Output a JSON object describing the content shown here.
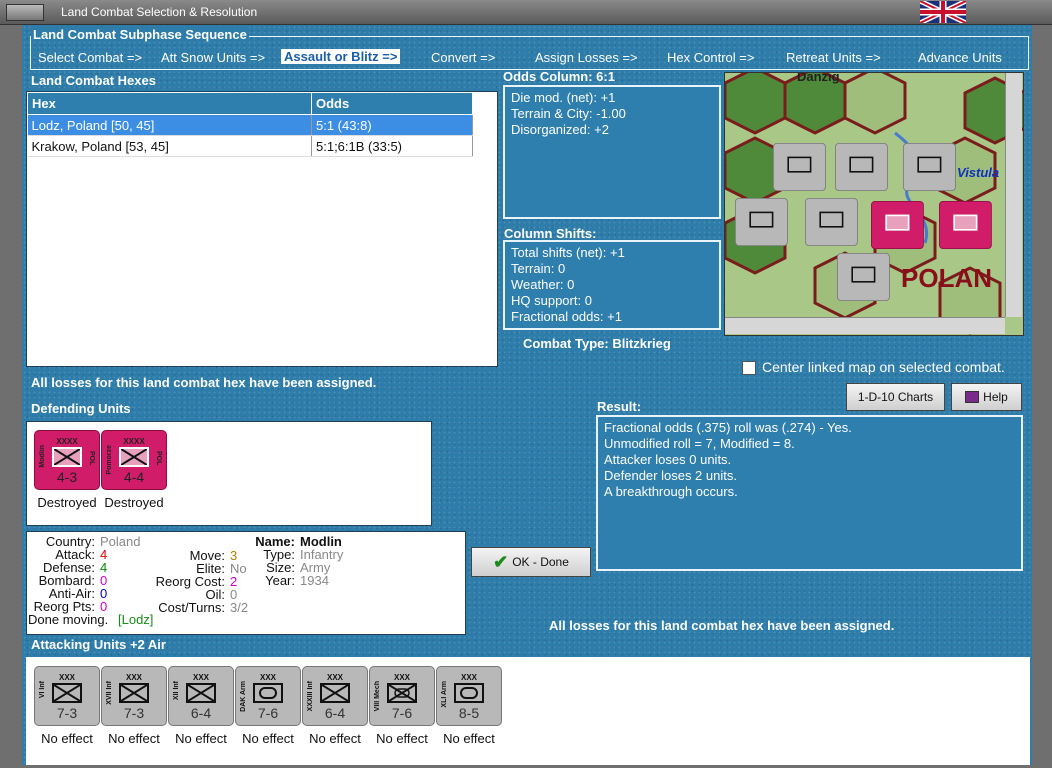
{
  "window": {
    "title": "Land Combat Selection & Resolution"
  },
  "sequence": {
    "title": "Land Combat Subphase Sequence",
    "steps": [
      "Select Combat =>",
      "Att Snow Units =>",
      "Assault or Blitz =>",
      "Convert =>",
      "Assign Losses =>",
      "Hex Control =>",
      "Retreat Units =>",
      "Advance Units"
    ],
    "active_step": "Assault or Blitz =>"
  },
  "hexes": {
    "title": "Land Combat Hexes",
    "columns": [
      "Hex",
      "Odds"
    ],
    "rows": [
      {
        "hex": "Lodz, Poland [50, 45]",
        "odds": "5:1 (43:8)"
      },
      {
        "hex": "Krakow, Poland [53, 45]",
        "odds": "5:1;6:1B (33:5)"
      }
    ]
  },
  "odds": {
    "title": "Odds Column: 6:1",
    "lines": [
      "Die mod. (net): +1",
      "Terrain & City: -1.00",
      "Disorganized: +2"
    ]
  },
  "shifts": {
    "title": "Column Shifts:",
    "lines": [
      "Total shifts (net): +1",
      "Terrain: 0",
      "Weather: 0",
      "HQ support: 0",
      "Fractional odds: +1"
    ]
  },
  "combat_type": "Combat Type:  Blitzkrieg",
  "center_map_label": "Center linked map on selected combat.",
  "losses_note": "All losses for this land combat hex have been assigned.",
  "buttons": {
    "charts": "1-D-10 Charts",
    "help": "Help",
    "done": "OK - Done"
  },
  "defenders": {
    "title": "Defending Units",
    "units": [
      {
        "size": "XXXX",
        "name": "Modlin",
        "nation": "POL",
        "strength": "4-3",
        "status": "Destroyed"
      },
      {
        "size": "XXXX",
        "name": "Pomorze",
        "nation": "POL",
        "strength": "4-4",
        "status": "Destroyed"
      }
    ]
  },
  "result": {
    "title": "Result:",
    "lines": [
      "Fractional odds (.375) roll was (.274)  - Yes.",
      "Unmodified roll = 7, Modified = 8.",
      "Attacker loses 0 units.",
      "Defender loses 2 units.",
      "A breakthrough occurs."
    ]
  },
  "unit_info": {
    "left": [
      {
        "k": "Country:",
        "v": "Poland",
        "c": "#888888"
      },
      {
        "k": "Attack:",
        "v": "4",
        "c": "#e00000"
      },
      {
        "k": "Defense:",
        "v": "4",
        "c": "#008800"
      },
      {
        "k": "Bombard:",
        "v": "0",
        "c": "#cc00cc"
      },
      {
        "k": "Anti-Air:",
        "v": "0",
        "c": "#0000cc"
      },
      {
        "k": "Reorg Pts:",
        "v": "0",
        "c": "#cc00cc"
      }
    ],
    "mid": [
      {
        "k": "Move:",
        "v": "3",
        "c": "#b08000"
      },
      {
        "k": "Elite:",
        "v": "No",
        "c": "#888888"
      },
      {
        "k": "Reorg Cost:",
        "v": "2",
        "c": "#cc00cc"
      },
      {
        "k": "Oil:",
        "v": "0",
        "c": "#888888"
      },
      {
        "k": "Cost/Turns:",
        "v": "3/2",
        "c": "#888888"
      }
    ],
    "right": [
      {
        "k": "Name:",
        "v": "Modlin",
        "c": "#111111",
        "bold": true
      },
      {
        "k": "Type:",
        "v": "Infantry",
        "c": "#888888"
      },
      {
        "k": "Size:",
        "v": "Army",
        "c": "#888888"
      },
      {
        "k": "Year:",
        "v": "1934",
        "c": "#888888"
      }
    ],
    "done_label": "Done moving.",
    "done_loc": "[Lodz]"
  },
  "attackers": {
    "title": "Attacking Units +2 Air",
    "units": [
      {
        "size": "XXX",
        "name": "VI Inf",
        "type": "infantry",
        "strength": "7-3",
        "status": "No effect"
      },
      {
        "size": "XXX",
        "name": "XVII Inf",
        "type": "infantry",
        "strength": "7-3",
        "status": "No effect"
      },
      {
        "size": "XXX",
        "name": "XII Inf",
        "type": "infantry-alt",
        "strength": "6-4",
        "status": "No effect"
      },
      {
        "size": "XXX",
        "name": "DAK Arm",
        "type": "armor",
        "strength": "7-6",
        "status": "No effect"
      },
      {
        "size": "XXX",
        "name": "XXXIII Inf",
        "type": "infantry-alt",
        "strength": "6-4",
        "status": "No effect"
      },
      {
        "size": "XXX",
        "name": "VIII Mech",
        "type": "mech",
        "strength": "7-6",
        "status": "No effect"
      },
      {
        "size": "XXX",
        "name": "XLI Arm",
        "type": "armor",
        "strength": "8-5",
        "status": "No effect"
      }
    ]
  },
  "map": {
    "labels": [
      "Danzig",
      "Vistula",
      "POLAN"
    ]
  },
  "colors": {
    "panel": "#2d7ca9",
    "selected_row": "#3b8ee3",
    "polish_unit": "#d11c6a",
    "german_unit": "#b8b8b8"
  }
}
